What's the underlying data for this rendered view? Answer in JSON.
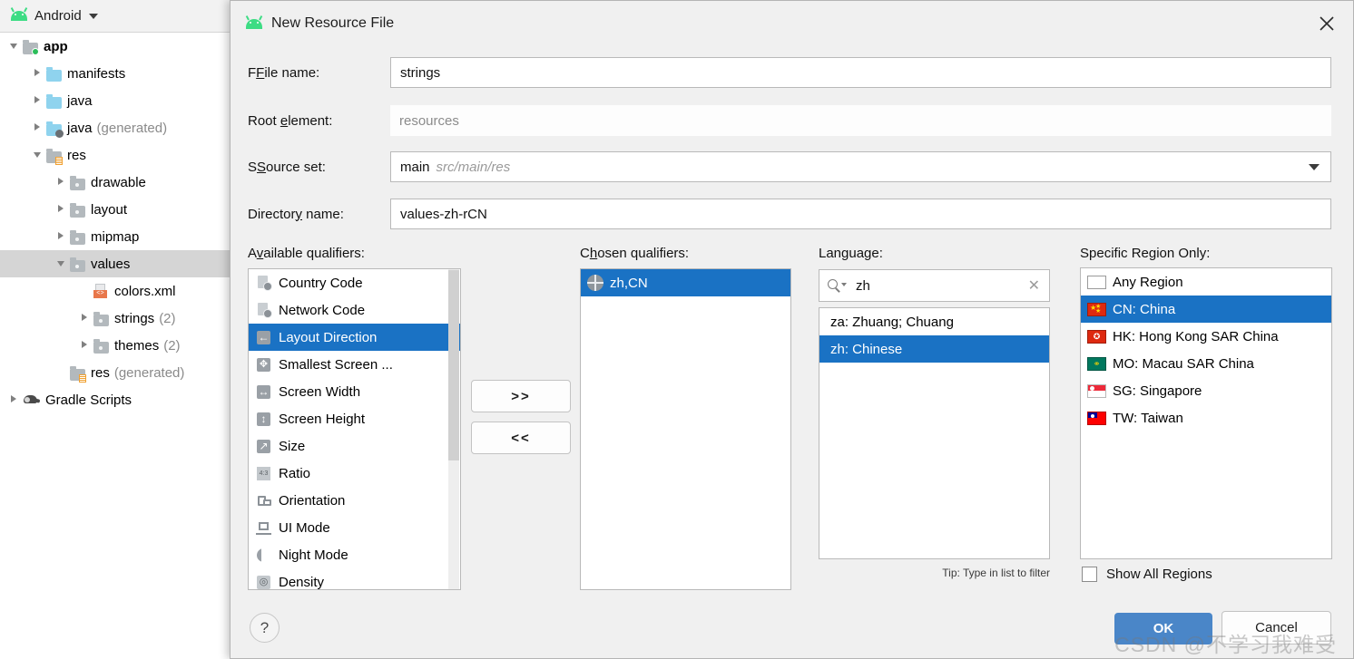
{
  "ide": {
    "toolbar": {
      "label": "Android",
      "icon": "android-robot-icon",
      "dropdown_icon": "caret-down-icon"
    },
    "tree": [
      {
        "label": "app",
        "suffix": "",
        "depth": 0,
        "twisty": "down",
        "icon": "folder-module",
        "bold": true
      },
      {
        "label": "manifests",
        "suffix": "",
        "depth": 1,
        "twisty": "right",
        "icon": "folder-blue",
        "bold": false
      },
      {
        "label": "java",
        "suffix": "",
        "depth": 1,
        "twisty": "right",
        "icon": "folder-blue",
        "bold": false
      },
      {
        "label": "java",
        "suffix": "(generated)",
        "depth": 1,
        "twisty": "right",
        "icon": "folder-generated-java",
        "bold": false
      },
      {
        "label": "res",
        "suffix": "",
        "depth": 1,
        "twisty": "down",
        "icon": "folder-res",
        "bold": false
      },
      {
        "label": "drawable",
        "suffix": "",
        "depth": 2,
        "twisty": "right",
        "icon": "folder-gray",
        "bold": false
      },
      {
        "label": "layout",
        "suffix": "",
        "depth": 2,
        "twisty": "right",
        "icon": "folder-gray",
        "bold": false
      },
      {
        "label": "mipmap",
        "suffix": "",
        "depth": 2,
        "twisty": "right",
        "icon": "folder-gray",
        "bold": false
      },
      {
        "label": "values",
        "suffix": "",
        "depth": 2,
        "twisty": "down",
        "icon": "folder-gray",
        "bold": false,
        "selected": true
      },
      {
        "label": "colors.xml",
        "suffix": "",
        "depth": 3,
        "twisty": "none",
        "icon": "xml-file",
        "bold": false
      },
      {
        "label": "strings",
        "suffix": "(2)",
        "depth": 3,
        "twisty": "right",
        "icon": "folder-gray",
        "bold": false
      },
      {
        "label": "themes",
        "suffix": "(2)",
        "depth": 3,
        "twisty": "right",
        "icon": "folder-gray",
        "bold": false
      },
      {
        "label": "res",
        "suffix": "(generated)",
        "depth": 2,
        "twisty": "none",
        "icon": "folder-res",
        "bold": false
      },
      {
        "label": "Gradle Scripts",
        "suffix": "",
        "depth": 0,
        "twisty": "right",
        "icon": "gradle-elephant",
        "bold": false
      }
    ]
  },
  "dialog": {
    "title": "New Resource File",
    "title_icon": "android-robot-icon",
    "close_icon": "close-icon",
    "fields": [
      {
        "label_pre": "F",
        "label_key": "F",
        "label_rest": "ile name:",
        "value": "strings",
        "hint": "",
        "type": "text",
        "flat": false
      },
      {
        "label_pre": "Root ",
        "label_key": "e",
        "label_rest": "lement:",
        "value": "resources",
        "hint": "",
        "type": "text",
        "flat": true
      },
      {
        "label_pre": "S",
        "label_key": "S",
        "label_rest": "ource set:",
        "value": "main",
        "hint": "src/main/res",
        "type": "select",
        "flat": false
      },
      {
        "label_pre": "Director",
        "label_key": "y",
        "label_rest": " name:",
        "value": "values-zh-rCN",
        "hint": "",
        "type": "text",
        "flat": false
      }
    ],
    "available": {
      "heading": "Available qualifiers:",
      "heading_accel": "v",
      "items": [
        {
          "label": "Country Code",
          "icon": "country-code-icon",
          "selected": false
        },
        {
          "label": "Network Code",
          "icon": "network-code-icon",
          "selected": false
        },
        {
          "label": "Layout Direction",
          "icon": "layout-direction-icon",
          "selected": true
        },
        {
          "label": "Smallest Screen ...",
          "icon": "smallest-screen-icon",
          "selected": false
        },
        {
          "label": "Screen Width",
          "icon": "screen-width-icon",
          "selected": false
        },
        {
          "label": "Screen Height",
          "icon": "screen-height-icon",
          "selected": false
        },
        {
          "label": "Size",
          "icon": "size-icon",
          "selected": false
        },
        {
          "label": "Ratio",
          "icon": "ratio-icon",
          "selected": false
        },
        {
          "label": "Orientation",
          "icon": "orientation-icon",
          "selected": false
        },
        {
          "label": "UI Mode",
          "icon": "ui-mode-icon",
          "selected": false
        },
        {
          "label": "Night Mode",
          "icon": "night-mode-icon",
          "selected": false
        },
        {
          "label": "Density",
          "icon": "density-icon",
          "selected": false
        }
      ]
    },
    "move_buttons": {
      "add_label": ">>",
      "remove_label": "<<"
    },
    "chosen": {
      "heading": "Chosen qualifiers:",
      "heading_accel": "h",
      "items": [
        {
          "label": "zh,CN",
          "icon": "globe-icon",
          "selected": true
        }
      ]
    },
    "language": {
      "heading": "Language:",
      "search_value": "zh",
      "search_icon": "search-icon",
      "clear_icon": "clear-icon",
      "items": [
        {
          "label": "za: Zhuang; Chuang",
          "selected": false
        },
        {
          "label": "zh: Chinese",
          "selected": true
        }
      ],
      "tip": "Tip: Type in list to filter"
    },
    "region": {
      "heading": "Specific Region Only:",
      "items": [
        {
          "label": "Any Region",
          "flag": "blank",
          "selected": false
        },
        {
          "label": "CN: China",
          "flag": "cn",
          "selected": true
        },
        {
          "label": "HK: Hong Kong SAR China",
          "flag": "hk",
          "selected": false
        },
        {
          "label": "MO: Macau SAR China",
          "flag": "mo",
          "selected": false
        },
        {
          "label": "SG: Singapore",
          "flag": "sg",
          "selected": false
        },
        {
          "label": "TW: Taiwan",
          "flag": "tw",
          "selected": false
        }
      ],
      "show_all_label": "Show All Regions",
      "show_all_checked": false
    },
    "footer": {
      "help_label": "?",
      "ok_label": "OK",
      "cancel_label": "Cancel"
    }
  },
  "watermark": "CSDN @不学习我难受",
  "colors": {
    "selection_blue": "#1a72c4",
    "ok_button_blue": "#4a86c8",
    "dialog_bg": "#f0f0f0",
    "tree_selection_gray": "#d5d5d5",
    "android_green": "#3ddc84"
  }
}
